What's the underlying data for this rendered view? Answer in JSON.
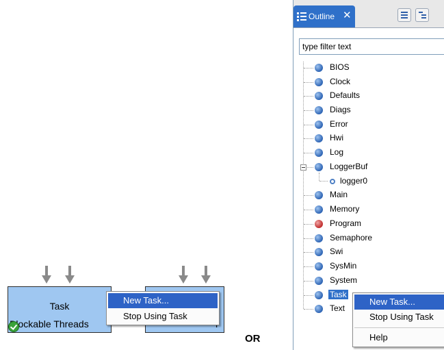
{
  "diagram": {
    "block_left": {
      "title": "Task",
      "subtitle": "Blockable Threads"
    },
    "block_right_partial": {
      "text": "r"
    },
    "context_menu_left": {
      "items": [
        "New Task...",
        "Stop Using Task"
      ],
      "selected_index": 0
    }
  },
  "separator_label": "OR",
  "outline": {
    "tab": {
      "label": "Outline",
      "close": "✕",
      "icon": "outline-icon"
    },
    "toolbar": [
      {
        "icon": "list-icon"
      },
      {
        "icon": "hierarchy-icon"
      }
    ],
    "filter_placeholder": "type filter text",
    "tree": [
      {
        "label": "BIOS",
        "status": "blue"
      },
      {
        "label": "Clock",
        "status": "blue"
      },
      {
        "label": "Defaults",
        "status": "blue"
      },
      {
        "label": "Diags",
        "status": "blue"
      },
      {
        "label": "Error",
        "status": "blue"
      },
      {
        "label": "Hwi",
        "status": "blue"
      },
      {
        "label": "Log",
        "status": "blue"
      },
      {
        "label": "LoggerBuf",
        "status": "blue",
        "expanded": true,
        "children": [
          {
            "label": "logger0"
          }
        ]
      },
      {
        "label": "Main",
        "status": "blue"
      },
      {
        "label": "Memory",
        "status": "blue"
      },
      {
        "label": "Program",
        "status": "red"
      },
      {
        "label": "Semaphore",
        "status": "blue"
      },
      {
        "label": "Swi",
        "status": "blue"
      },
      {
        "label": "SysMin",
        "status": "blue"
      },
      {
        "label": "System",
        "status": "blue"
      },
      {
        "label": "Task",
        "status": "blue",
        "selected": true
      },
      {
        "label": "Text",
        "status": "blue"
      }
    ],
    "context_menu": {
      "items": [
        "New Task...",
        "Stop Using Task",
        "Help"
      ],
      "selected_index": 0
    }
  }
}
